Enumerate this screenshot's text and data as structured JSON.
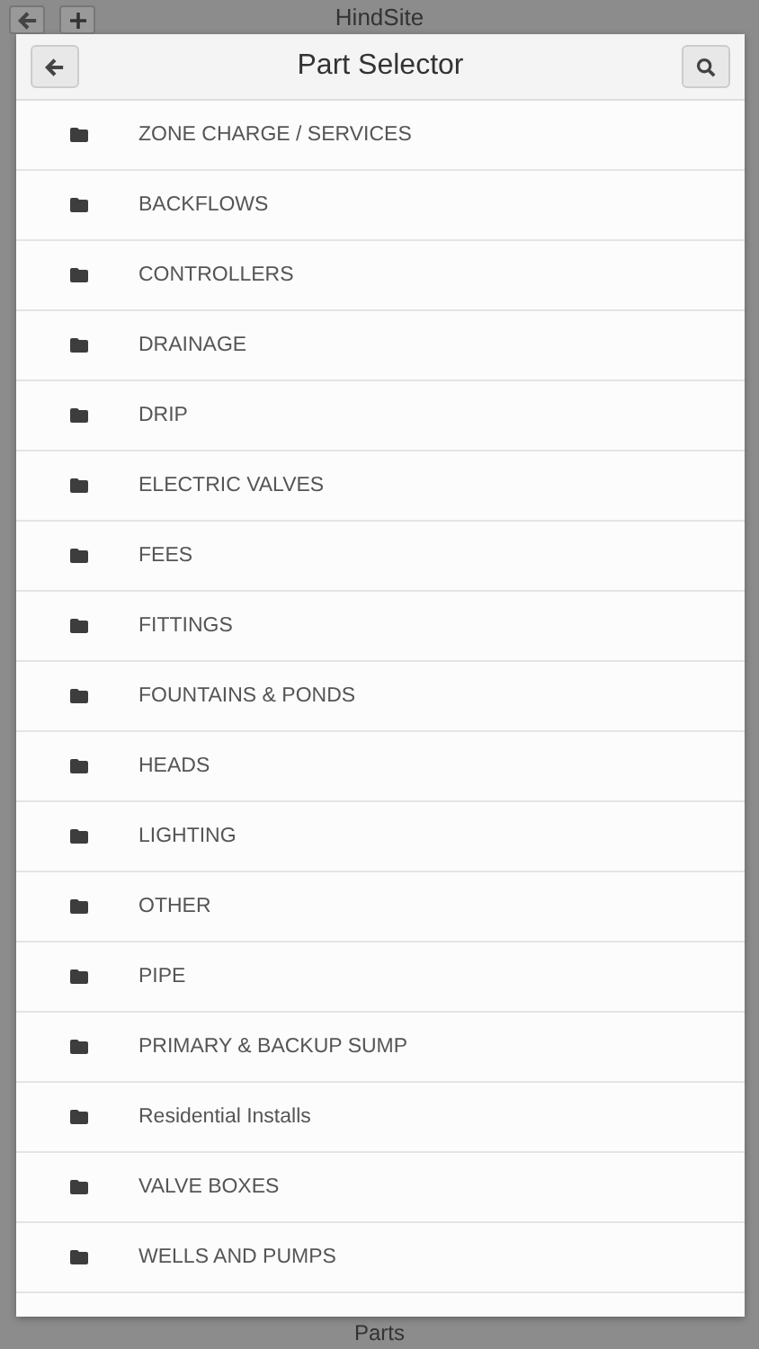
{
  "app": {
    "title": "HindSite",
    "footer_title": "Parts"
  },
  "dialog": {
    "title": "Part Selector",
    "items": [
      {
        "label": "ZONE CHARGE / SERVICES",
        "kind": "folder"
      },
      {
        "label": "BACKFLOWS",
        "kind": "folder"
      },
      {
        "label": "CONTROLLERS",
        "kind": "folder"
      },
      {
        "label": "DRAINAGE",
        "kind": "folder"
      },
      {
        "label": "DRIP",
        "kind": "folder"
      },
      {
        "label": "ELECTRIC VALVES",
        "kind": "folder"
      },
      {
        "label": "FEES",
        "kind": "folder"
      },
      {
        "label": "FITTINGS",
        "kind": "folder"
      },
      {
        "label": "FOUNTAINS & PONDS",
        "kind": "folder"
      },
      {
        "label": "HEADS",
        "kind": "folder"
      },
      {
        "label": "LIGHTING",
        "kind": "folder"
      },
      {
        "label": "OTHER",
        "kind": "folder"
      },
      {
        "label": "PIPE",
        "kind": "folder"
      },
      {
        "label": "PRIMARY & BACKUP SUMP",
        "kind": "folder"
      },
      {
        "label": "Residential Installs",
        "kind": "folder"
      },
      {
        "label": "VALVE BOXES",
        "kind": "folder"
      },
      {
        "label": "WELLS AND PUMPS",
        "kind": "folder"
      }
    ]
  }
}
